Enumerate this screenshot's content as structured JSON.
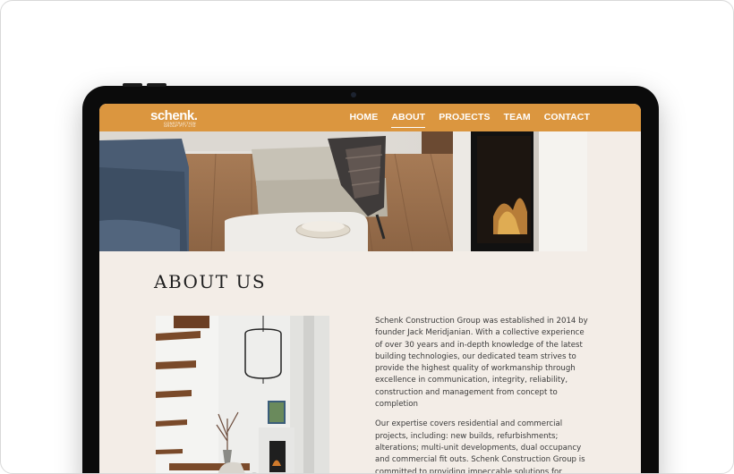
{
  "site": {
    "logo_word": "schenk.",
    "logo_sub_1": "CONSTRUCTION",
    "logo_sub_2": "GROUP PTY LTD"
  },
  "nav": {
    "items": [
      {
        "label": "HOME",
        "active": false
      },
      {
        "label": "ABOUT",
        "active": true
      },
      {
        "label": "PROJECTS",
        "active": false
      },
      {
        "label": "TEAM",
        "active": false
      },
      {
        "label": "CONTACT",
        "active": false
      }
    ]
  },
  "about": {
    "title": "ABOUT US",
    "paragraph_1": "Schenk Construction Group was established in 2014 by founder Jack Meridjanian. With a collective experience of over 30 years and in-depth knowledge of the latest building technologies, our dedicated team strives to provide the highest quality of workmanship through excellence in communication, integrity, reliability, construction and management from concept to completion",
    "paragraph_2": "Our expertise covers residential and commercial projects, including: new builds, refurbishments; alterations; multi-unit developments, dual occupancy and commercial fit outs. Schenk Construction Group is committed to providing impeccable solutions for"
  },
  "colors": {
    "nav_bar": "#db963f",
    "page_background": "#f3ede7",
    "text": "#3a3a3a",
    "device_bezel": "#0b0b0b"
  },
  "images": {
    "hero": "living-room-interior-photo",
    "side": "staircase-interior-photo"
  }
}
